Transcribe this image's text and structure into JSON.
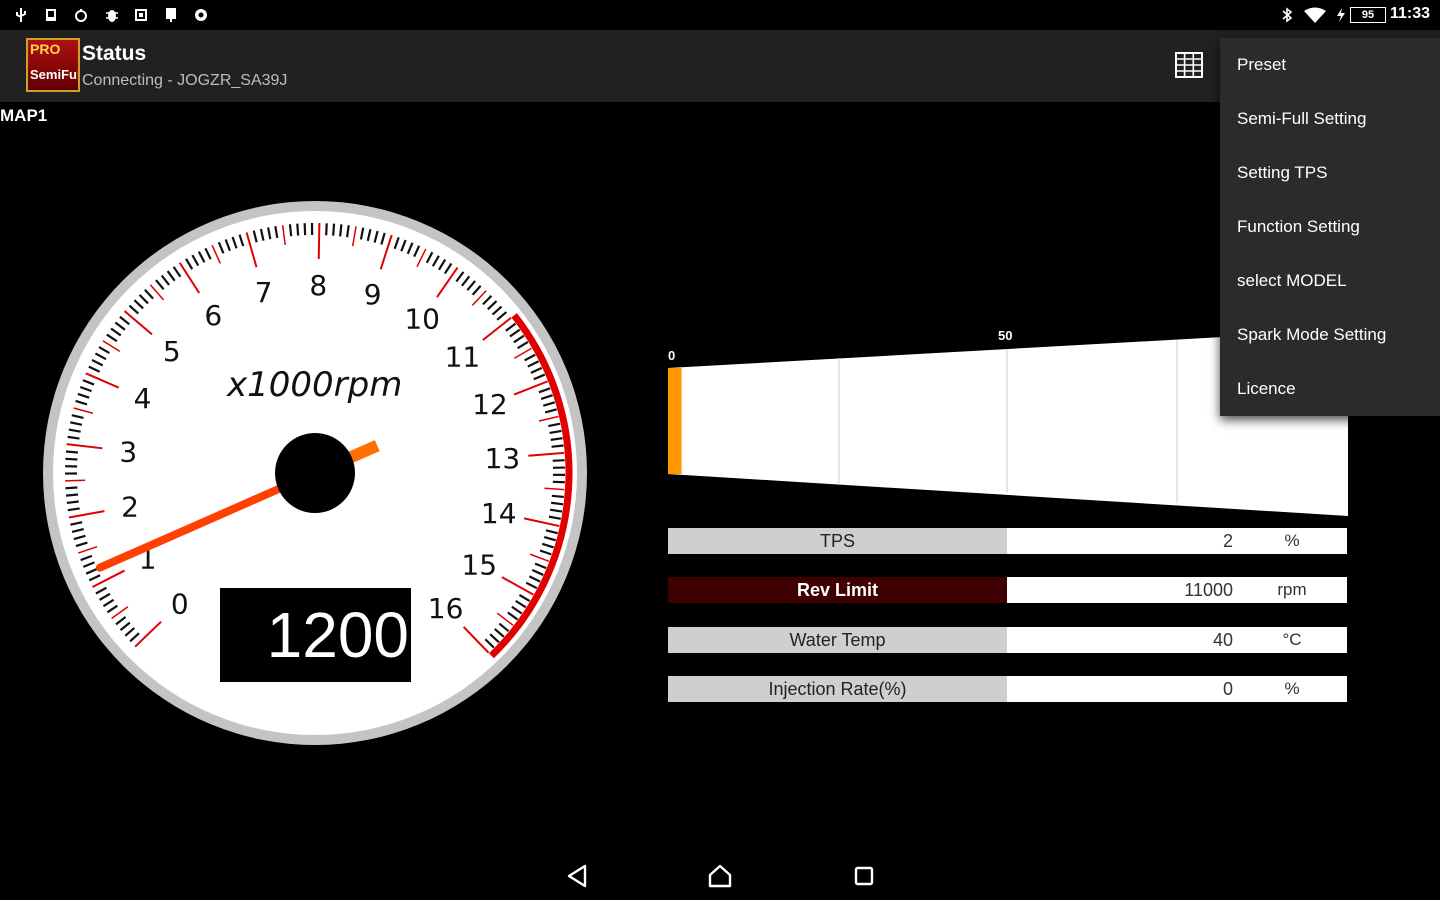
{
  "status_bar": {
    "left_icons": [
      "usb-icon",
      "download-icon",
      "alarm-icon",
      "debug-icon",
      "screenshot-icon",
      "gallery-icon",
      "settings-icon"
    ],
    "right_icons": [
      "bluetooth-icon",
      "wifi-icon",
      "charging-icon"
    ],
    "battery": "95",
    "time": "11:33"
  },
  "app_bar": {
    "logo_text_top": "PRO",
    "logo_text_bottom": "SemiFull",
    "title": "Status",
    "subtitle": "Connecting - JOGZR_SA39J",
    "grid_icon": "grid-icon"
  },
  "map_label": "MAP1",
  "gauge": {
    "unit_label": "x1000rpm",
    "min": 0,
    "max": 16,
    "redline_from": 11,
    "tick_labels": [
      "0",
      "1",
      "2",
      "3",
      "4",
      "5",
      "6",
      "7",
      "8",
      "9",
      "10",
      "11",
      "12",
      "13",
      "14",
      "15",
      "16"
    ],
    "needle_value": 1.2,
    "rpm_readout": "1200",
    "colors": {
      "redline": "#e00000",
      "needle": "#ff4000",
      "face": "#ffffff",
      "rim": "#c0c0c0"
    }
  },
  "bar_graph": {
    "scale_start": "0",
    "scale_mid": "50",
    "value_fraction": 0.02,
    "bar_color": "#ff9800"
  },
  "readings": [
    {
      "label": "TPS",
      "value": "2",
      "unit": "%",
      "alert": false
    },
    {
      "label": "Rev Limit",
      "value": "11000",
      "unit": "rpm",
      "alert": true
    },
    {
      "label": "Water Temp",
      "value": "40",
      "unit": "°C",
      "alert": false
    },
    {
      "label": "Injection Rate(%)",
      "value": "0",
      "unit": "%",
      "alert": false
    }
  ],
  "menu": {
    "items": [
      "Preset",
      "Semi-Full Setting",
      "Setting TPS",
      "Function Setting",
      "select MODEL",
      "Spark Mode Setting",
      "Licence"
    ]
  },
  "nav_bar": {
    "back_icon": "back-icon",
    "home_icon": "home-icon",
    "recents_icon": "recents-icon"
  }
}
